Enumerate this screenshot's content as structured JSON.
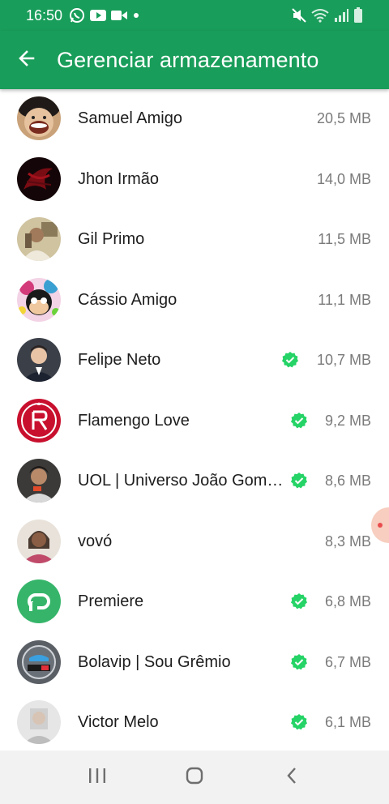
{
  "status_bar": {
    "time": "16:50",
    "left_icons": [
      "whatsapp-icon",
      "youtube-icon",
      "video-icon",
      "dot-icon"
    ],
    "right_icons": [
      "mute-icon",
      "wifi-icon",
      "signal-icon",
      "battery-icon"
    ]
  },
  "app_bar": {
    "title": "Gerenciar armazenamento",
    "back_icon": "arrow-left-icon"
  },
  "colors": {
    "brand_green": "#199d5a",
    "verified_green": "#25d366",
    "size_gray": "#7a7a7a"
  },
  "chats": [
    {
      "name": "Samuel Amigo",
      "size": "20,5 MB",
      "verified": false,
      "avatar": "anime-character-avatar"
    },
    {
      "name": "Jhon Irmão",
      "size": "14,0 MB",
      "verified": false,
      "avatar": "dark-red-pattern-avatar"
    },
    {
      "name": "Gil Primo",
      "size": "11,5 MB",
      "verified": false,
      "avatar": "person-photo-avatar"
    },
    {
      "name": "Cássio Amigo",
      "size": "11,1 MB",
      "verified": false,
      "avatar": "cartoon-mouse-avatar"
    },
    {
      "name": "Felipe Neto",
      "size": "10,7 MB",
      "verified": true,
      "avatar": "person-photo-avatar"
    },
    {
      "name": "Flamengo Love",
      "size": "9,2 MB",
      "verified": true,
      "avatar": "flamengo-crest-avatar"
    },
    {
      "name": "UOL | Universo João Gom…",
      "size": "8,6 MB",
      "verified": true,
      "avatar": "person-photo-avatar"
    },
    {
      "name": "vovó",
      "size": "8,3 MB",
      "verified": false,
      "avatar": "person-photo-avatar"
    },
    {
      "name": "Premiere",
      "size": "6,8 MB",
      "verified": true,
      "avatar": "premiere-logo-avatar"
    },
    {
      "name": "Bolavip | Sou Grêmio",
      "size": "6,7 MB",
      "verified": true,
      "avatar": "gremio-badge-avatar"
    },
    {
      "name": "Victor Melo",
      "size": "6,1 MB",
      "verified": true,
      "avatar": "person-photo-avatar"
    }
  ],
  "nav_bar": {
    "icons": [
      "recent-apps-icon",
      "home-icon",
      "back-icon"
    ]
  }
}
